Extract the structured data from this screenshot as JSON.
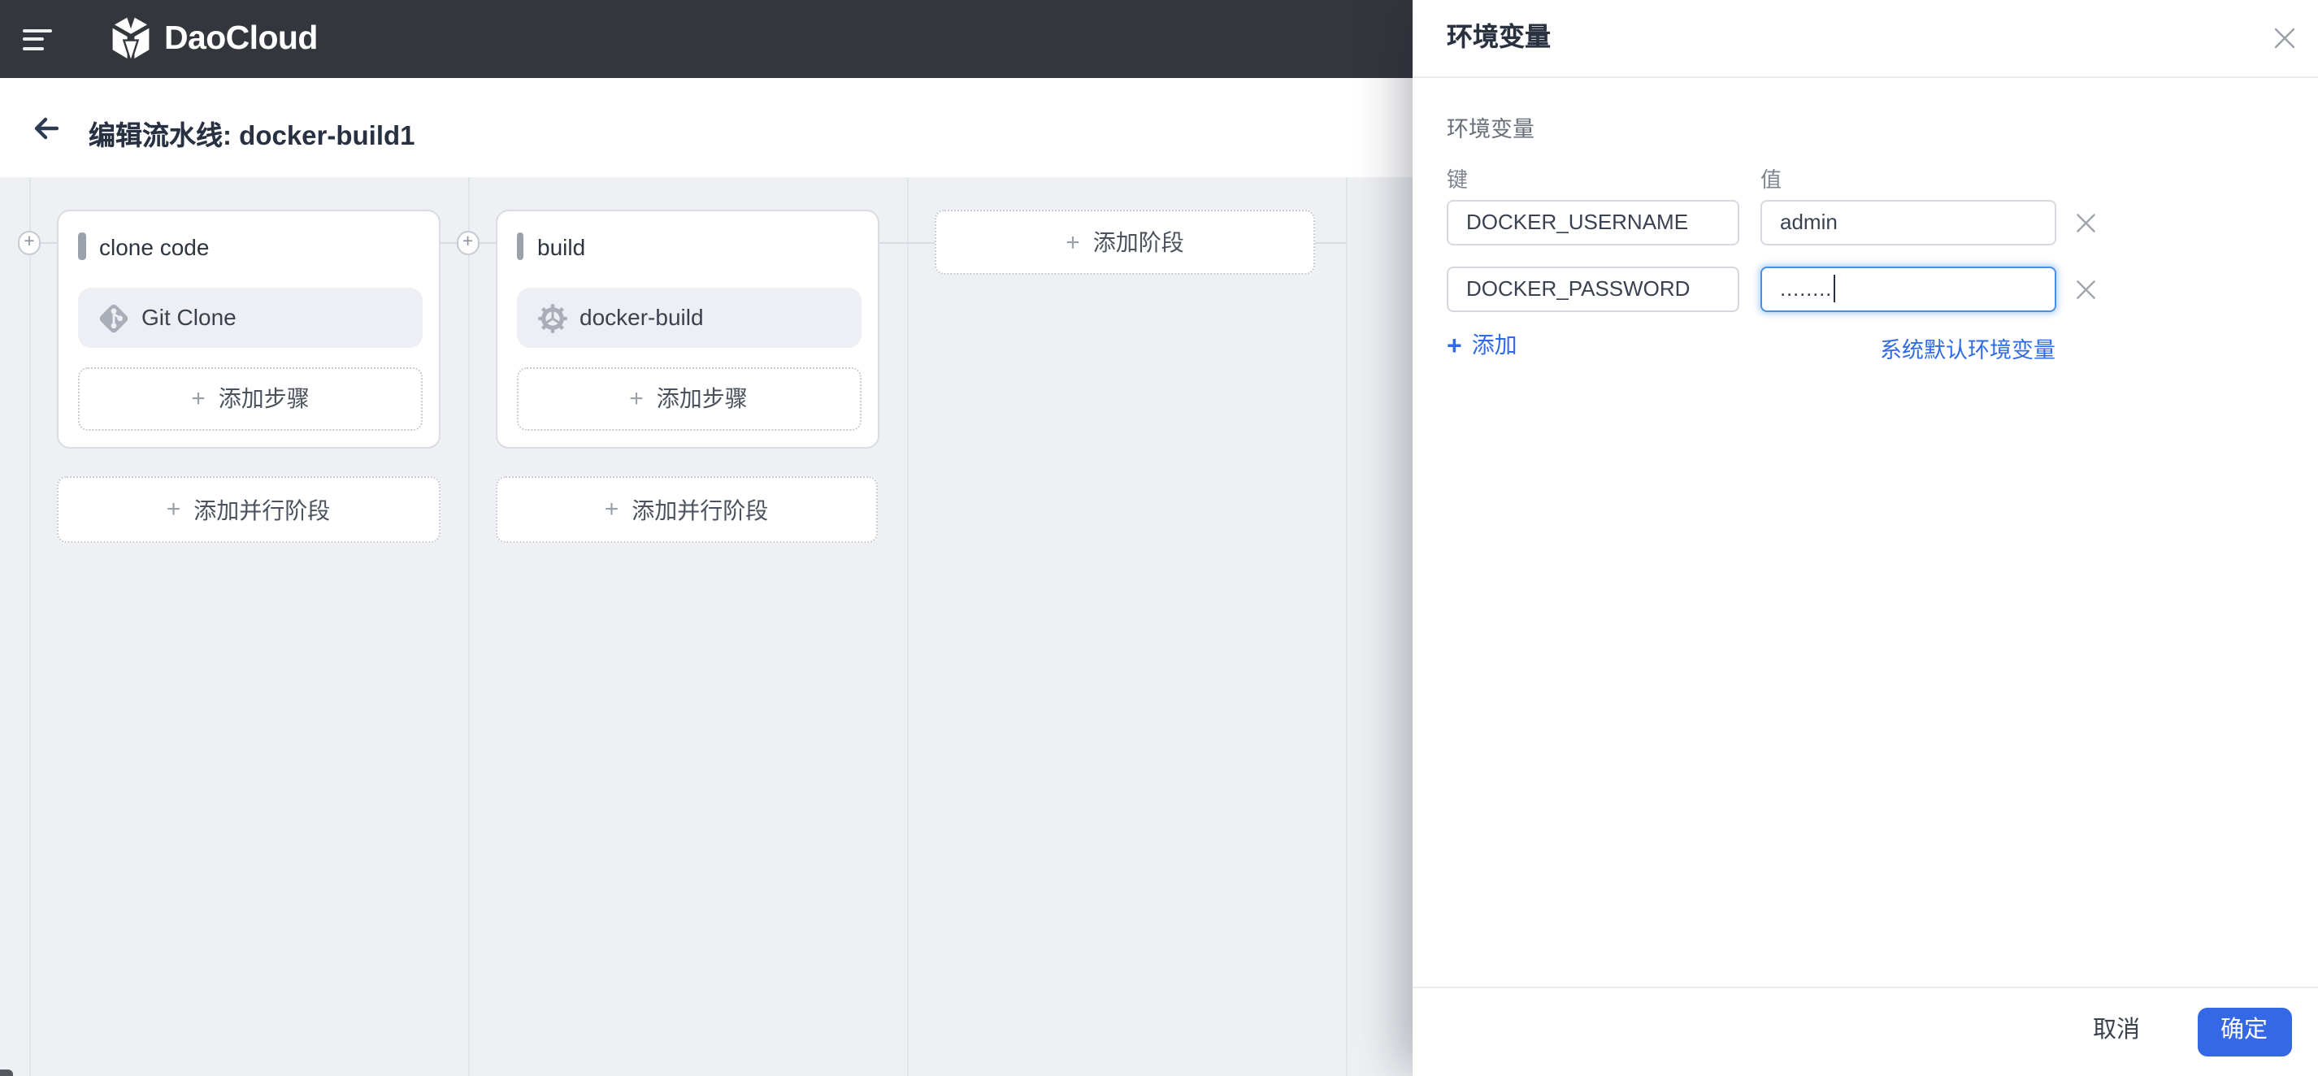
{
  "topbar": {
    "brand": "DaoCloud"
  },
  "header": {
    "title": "编辑流水线: docker-build1"
  },
  "canvas": {
    "stages": [
      {
        "name": "clone code",
        "steps": [
          {
            "label": "Git Clone",
            "icon": "git-icon"
          }
        ],
        "add_step_label": "添加步骤",
        "add_parallel_label": "添加并行阶段"
      },
      {
        "name": "build",
        "steps": [
          {
            "label": "docker-build",
            "icon": "gear-icon"
          }
        ],
        "add_step_label": "添加步骤",
        "add_parallel_label": "添加并行阶段"
      }
    ],
    "add_stage_label": "添加阶段",
    "plus_symbol": "+"
  },
  "panel": {
    "title": "环境变量",
    "section_label": "环境变量",
    "key_label": "键",
    "value_label": "值",
    "rows": [
      {
        "key": "DOCKER_USERNAME",
        "value": "admin",
        "masked": false
      },
      {
        "key": "DOCKER_PASSWORD",
        "value_display": "........",
        "masked": true,
        "focused": true
      }
    ],
    "add_label": "添加",
    "system_defaults_label": "系统默认环境变量",
    "cancel_label": "取消",
    "confirm_label": "确定",
    "accent_color": "#2f6be4"
  }
}
